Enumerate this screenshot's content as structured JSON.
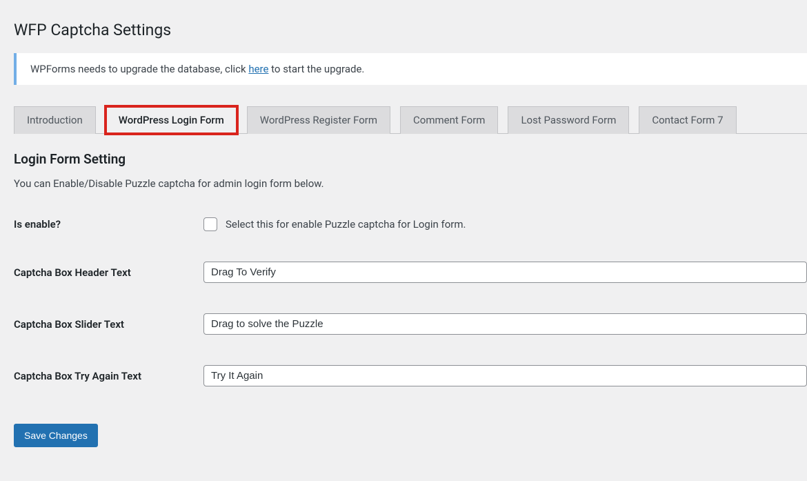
{
  "page_title": "WFP Captcha Settings",
  "notice": {
    "text_before": "WPForms needs to upgrade the database, click ",
    "link_text": "here",
    "text_after": " to start the upgrade."
  },
  "tabs": [
    {
      "label": "Introduction",
      "active": false,
      "highlighted": false
    },
    {
      "label": "WordPress Login Form",
      "active": true,
      "highlighted": true
    },
    {
      "label": "WordPress Register Form",
      "active": false,
      "highlighted": false
    },
    {
      "label": "Comment Form",
      "active": false,
      "highlighted": false
    },
    {
      "label": "Lost Password Form",
      "active": false,
      "highlighted": false
    },
    {
      "label": "Contact Form 7",
      "active": false,
      "highlighted": false
    }
  ],
  "section": {
    "heading": "Login Form Setting",
    "description": "You can Enable/Disable Puzzle captcha for admin login form below."
  },
  "fields": {
    "is_enable": {
      "label": "Is enable?",
      "checkbox_label": "Select this for enable Puzzle captcha for Login form.",
      "checked": false
    },
    "header_text": {
      "label": "Captcha Box Header Text",
      "value": "Drag To Verify"
    },
    "slider_text": {
      "label": "Captcha Box Slider Text",
      "value": "Drag to solve the Puzzle"
    },
    "try_again_text": {
      "label": "Captcha Box Try Again Text",
      "value": "Try It Again"
    }
  },
  "submit_label": "Save Changes"
}
